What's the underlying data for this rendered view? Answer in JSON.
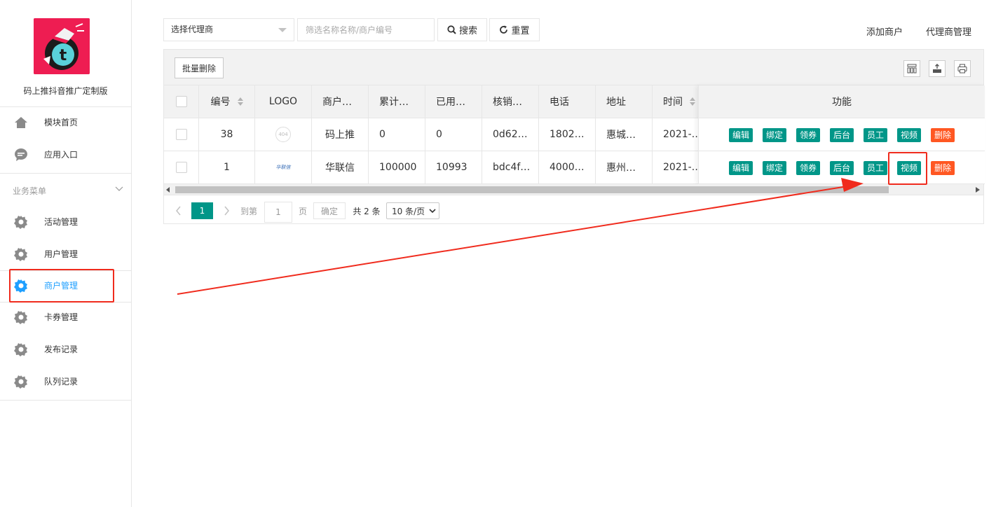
{
  "app": {
    "name": "码上推抖音推广定制版"
  },
  "sidebar": {
    "items_top": [
      {
        "label": "模块首页",
        "icon": "home-icon"
      },
      {
        "label": "应用入口",
        "icon": "chat-icon"
      }
    ],
    "group_title": "业务菜单",
    "items": [
      {
        "label": "活动管理",
        "icon": "gear-icon"
      },
      {
        "label": "用户管理",
        "icon": "gear-icon"
      },
      {
        "label": "商户管理",
        "icon": "gear-icon",
        "active": true
      },
      {
        "label": "卡券管理",
        "icon": "gear-icon"
      },
      {
        "label": "发布记录",
        "icon": "gear-icon"
      },
      {
        "label": "队列记录",
        "icon": "gear-icon"
      }
    ]
  },
  "toolbar": {
    "agent_select_value": "选择代理商",
    "search_placeholder": "筛选名称名称/商户编号",
    "search_label": "搜索",
    "reset_label": "重置",
    "add_merchant": "添加商户",
    "agent_manage": "代理商管理"
  },
  "table": {
    "batch_delete": "批量删除",
    "columns": [
      "编号",
      "LOGO",
      "商户…",
      "累计…",
      "已用…",
      "核销…",
      "电话",
      "地址",
      "时间",
      "功能"
    ],
    "rows": [
      {
        "id": "38",
        "logo": "404",
        "name": "码上推",
        "total": "0",
        "used": "0",
        "code": "0d62…",
        "phone": "1802…",
        "address": "惠城…",
        "time": "2021-…"
      },
      {
        "id": "1",
        "logo": "华联信",
        "name": "华联信",
        "total": "100000",
        "used": "10993",
        "code": "bdc4f…",
        "phone": "4000…",
        "address": "惠州…",
        "time": "2021-…"
      }
    ],
    "actions": [
      "编辑",
      "绑定",
      "领券",
      "后台",
      "员工",
      "视频",
      "删除"
    ]
  },
  "pager": {
    "current": "1",
    "goto_label": "到第",
    "goto_value": "1",
    "page_unit": "页",
    "confirm": "确定",
    "total": "共 2 条",
    "page_size": "10 条/页"
  },
  "colors": {
    "primary_green": "#009688",
    "danger_orange": "#FF5722",
    "active_blue": "#1E9FFF",
    "annotation_red": "#f02b1d"
  }
}
